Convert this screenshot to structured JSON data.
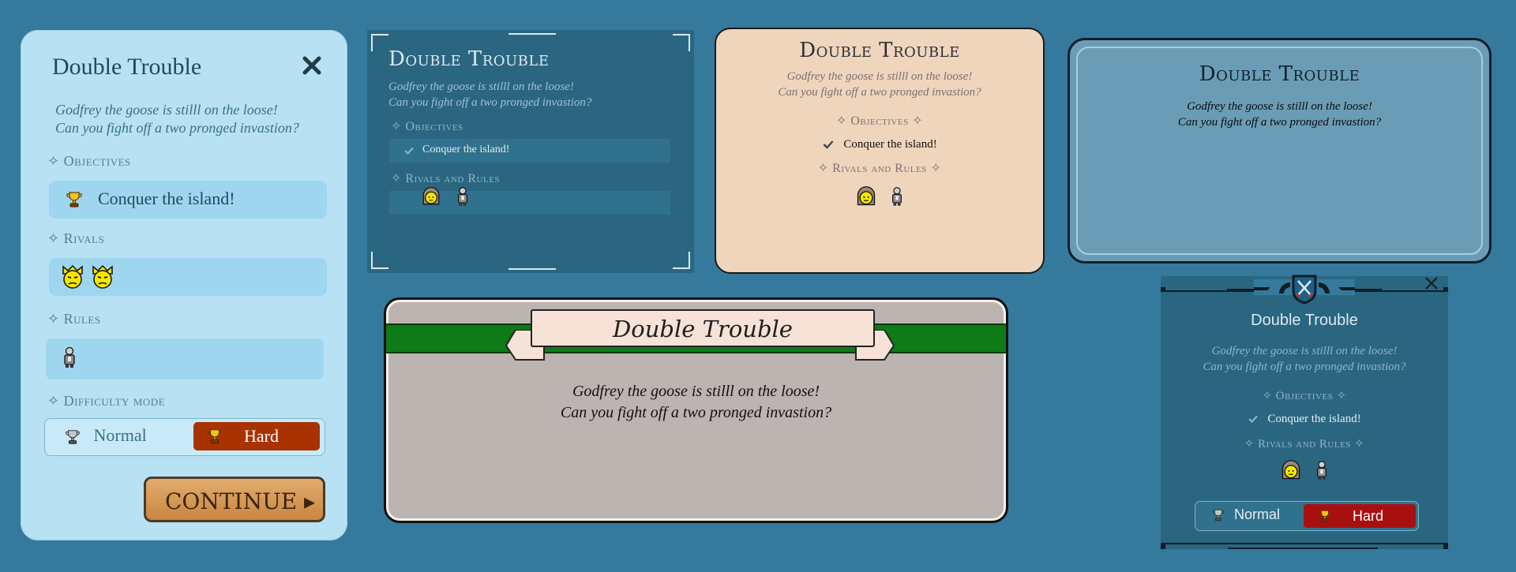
{
  "colors": {
    "background": "#357a9c",
    "hard_button_panel1": "#a83200",
    "hard_button_panel6": "#a81010",
    "green_band": "#0e7a18",
    "continue_button": "#d49a58"
  },
  "panel1": {
    "title": "Double Trouble",
    "close_icon": "close-x-icon",
    "desc_line1": "Godfrey the goose is stilll on the loose!",
    "desc_line2": "Can you fight off a two pronged invastion?",
    "objectives_heading": "✧ Objectives",
    "objective_text": "Conquer the island!",
    "rivals_heading": "✧ Rivals",
    "rules_heading": "✧ Rules",
    "difficulty_heading": "✧ Difficulty mode",
    "difficulty_normal": "Normal",
    "difficulty_hard": "Hard",
    "selected_difficulty": "Hard",
    "continue_label": "CONTINUE ▸"
  },
  "panel2": {
    "title": "Double Trouble",
    "desc_line1": "Godfrey the goose is stilll on the loose!",
    "desc_line2": "Can you fight off a two pronged invastion?",
    "objectives_heading": "✧ Objectives",
    "objective_text": "Conquer the island!",
    "rivals_rules_heading": "✧ Rivals and Rules"
  },
  "panel3": {
    "title": "Double Trouble",
    "desc_line1": "Godfrey the goose is stilll on the loose!",
    "desc_line2": "Can you fight off a two pronged invastion?",
    "objectives_heading": "✧ Objectives ✧",
    "objective_text": "Conquer the island!",
    "rivals_rules_heading": "✧ Rivals and Rules ✧"
  },
  "panel4": {
    "title": "Double Trouble",
    "desc_line1": "Godfrey the goose is stilll on the loose!",
    "desc_line2": "Can you fight off a two pronged invastion?"
  },
  "panel5": {
    "title": "Double Trouble",
    "desc_line1": "Godfrey the goose is stilll on the loose!",
    "desc_line2": "Can you fight off a two pronged invastion?"
  },
  "panel6": {
    "title": "Double Trouble",
    "close_icon": "close-x-icon",
    "desc_line1": "Godfrey the goose is stilll on the loose!",
    "desc_line2": "Can you fight off a two pronged invastion?",
    "objectives_heading": "✧ Objectives ✧",
    "objective_text": "Conquer the island!",
    "rivals_rules_heading": "✧ Rivals and Rules ✧",
    "difficulty_normal": "Normal",
    "difficulty_hard": "Hard",
    "selected_difficulty": "Hard"
  }
}
